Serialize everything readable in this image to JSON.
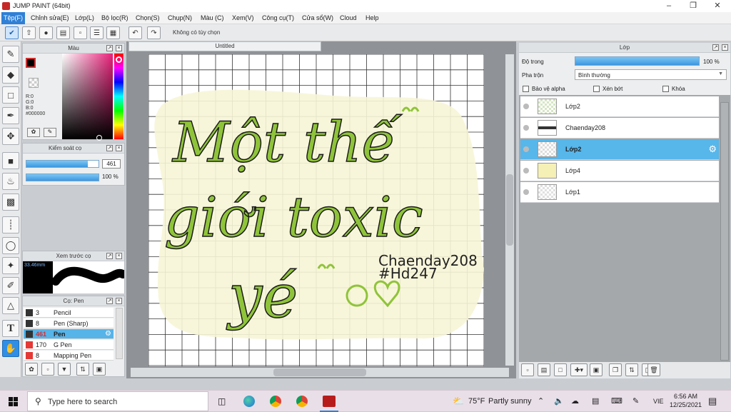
{
  "window": {
    "title": "JUMP PAINT (64bit)"
  },
  "menu": [
    "Tệp(F)",
    "Chỉnh sửa(E)",
    "Lớp(L)",
    "Bộ lọc(R)",
    "Chọn(S)",
    "Chụp(N)",
    "Màu (C)",
    "Xem(V)",
    "Công cụ(T)",
    "Cửa sổ(W)",
    "Cloud",
    "Help"
  ],
  "toolbar": {
    "option_label": "Không có tùy chọn"
  },
  "color_panel": {
    "title": "Màu",
    "rgb": [
      "R:0",
      "G:0",
      "B:0"
    ],
    "hex": "#000000",
    "main_color": "#000000"
  },
  "brush_control": {
    "title": "Kiểm soát cọ",
    "size_value": "461",
    "opacity_value": "100 %",
    "size_fill": 0.85,
    "opacity_fill": 1.0
  },
  "brush_preview": {
    "title": "Xem trước cọ",
    "size_text": "33.46mm"
  },
  "brush_list": {
    "title": "Cọ: Pen",
    "items": [
      {
        "size": "3",
        "name": "Pencil",
        "color": "#333333"
      },
      {
        "size": "8",
        "name": "Pen (Sharp)",
        "color": "#333333"
      },
      {
        "size": "461",
        "name": "Pen",
        "color": "#333333"
      },
      {
        "size": "170",
        "name": "G Pen",
        "color": "#e53935"
      },
      {
        "size": "8",
        "name": "Mapping Pen",
        "color": "#e53935"
      }
    ],
    "selected_index": 2
  },
  "document": {
    "tab_title": "Untitled"
  },
  "artwork": {
    "line1": "Một thế",
    "line2": "giới toxic",
    "line3": "yé",
    "sig1": "Chaenday208",
    "sig2": "#Hd247",
    "stroke_color": "#8fc43a",
    "blob_color": "#f7f5d6"
  },
  "layer_panel": {
    "title": "Lớp",
    "opacity_label": "Độ trong",
    "opacity_value": "100 %",
    "opacity_fill": 1.0,
    "blend_label": "Pha trộn",
    "blend_value": "Bình thường",
    "protect_alpha": "Bảo vệ alpha",
    "clipping": "Xén bớt",
    "lock": "Khóa",
    "layers": [
      {
        "name": "Lớp2",
        "thumb": "green"
      },
      {
        "name": "Chaenday208",
        "thumb": "text"
      },
      {
        "name": "Lớp2",
        "thumb": "sketch",
        "selected": true
      },
      {
        "name": "Lớp4",
        "thumb": "yellow"
      },
      {
        "name": "Lớp1",
        "thumb": "empty"
      }
    ]
  },
  "taskbar": {
    "search_placeholder": "Type here to search",
    "weather_temp": "75°F",
    "weather_text": "Partly sunny",
    "lang": "VIE",
    "time": "6:56 AM",
    "date": "12/25/2021"
  }
}
